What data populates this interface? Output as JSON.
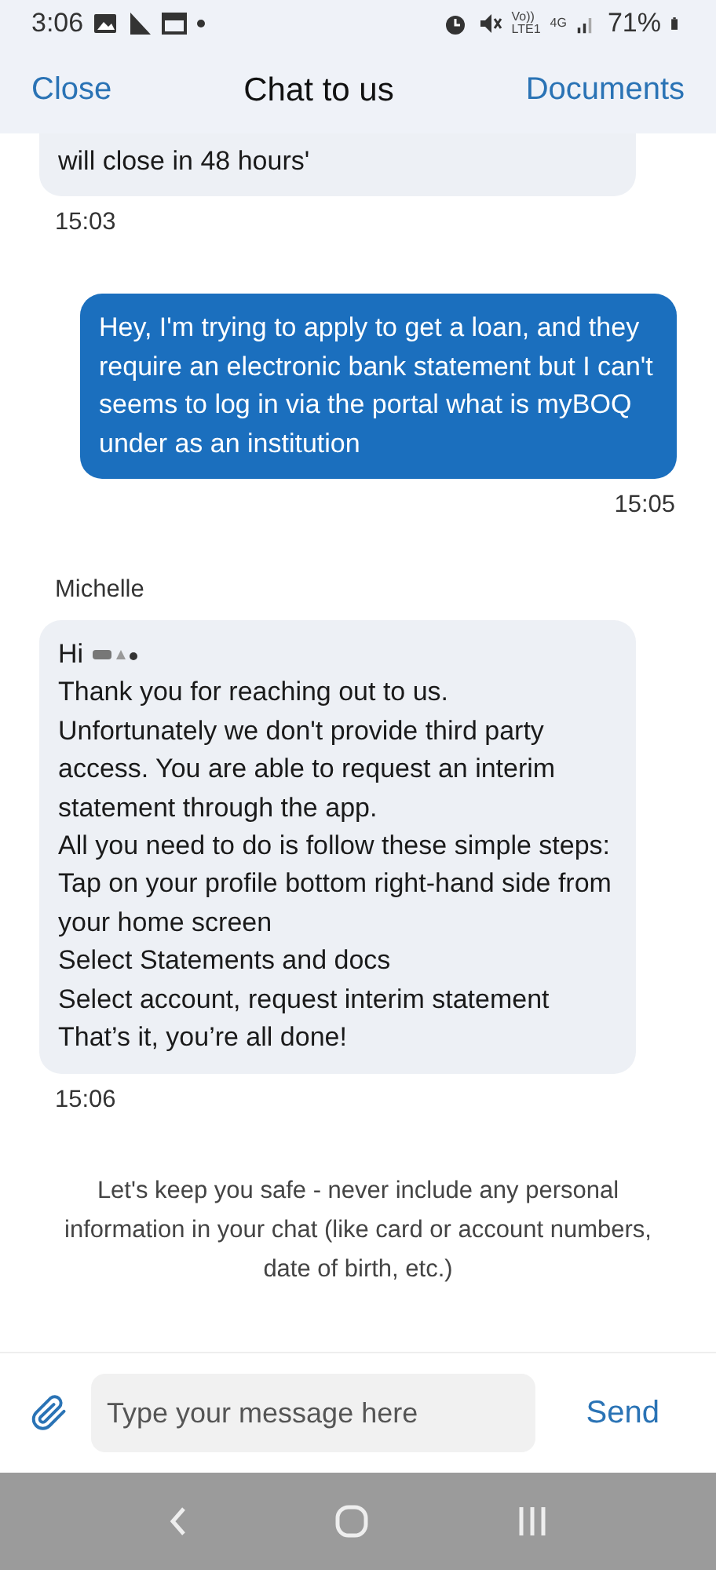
{
  "status_bar": {
    "time": "3:06",
    "network": [
      "Vo))",
      "LTE1",
      "4G"
    ],
    "battery": "71%"
  },
  "header": {
    "left": "Close",
    "title": "Chat to us",
    "right": "Documents"
  },
  "messages": [
    {
      "kind": "incoming",
      "cut_top": true,
      "lines": [
        "will close in 48 hours'"
      ],
      "time": "15:03"
    },
    {
      "kind": "outgoing",
      "lines": [
        "Hey, I'm trying to apply to get a loan, and they require an electronic bank statement but I can't seems to log in via the portal what is myBOQ under as an institution"
      ],
      "time": "15:05"
    },
    {
      "kind": "incoming",
      "sender": "Michelle",
      "greeting": "Hi",
      "redacted_name": true,
      "lines": [
        "Thank you for reaching out to us.",
        "Unfortunately we don't provide third party access. You are able to request an interim statement through the app.",
        "All you need to do is follow these simple steps:",
        "Tap on your profile bottom right-hand side from your home screen",
        "Select Statements and docs",
        "Select account, request interim statement",
        "That’s it, you’re all done!"
      ],
      "time": "15:06"
    }
  ],
  "notice": "Let's keep you safe - never include any personal information in your chat (like card or account numbers, date of birth, etc.)",
  "composer": {
    "placeholder": "Type your message here",
    "send": "Send"
  }
}
